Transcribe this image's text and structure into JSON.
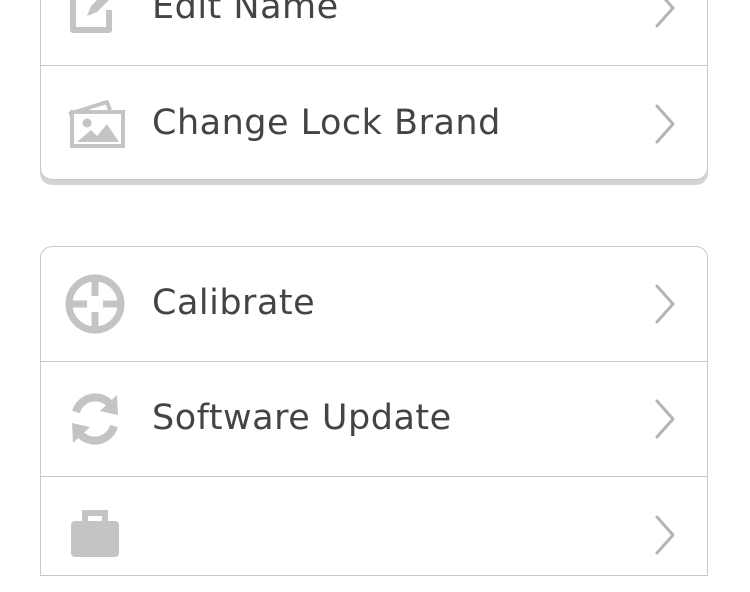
{
  "colors": {
    "icon": "#c4c4c4",
    "text": "#444444",
    "chevron": "#b4b4b4",
    "border": "#c8c8c8",
    "shadow": "#d4d4d4"
  },
  "groups": [
    {
      "items": [
        {
          "label": "Edit Name",
          "icon": "edit-icon"
        },
        {
          "label": "Change Lock Brand",
          "icon": "image-icon"
        }
      ]
    },
    {
      "items": [
        {
          "label": "Calibrate",
          "icon": "crosshair-icon"
        },
        {
          "label": "Software Update",
          "icon": "refresh-icon"
        },
        {
          "label": "",
          "icon": "briefcase-icon"
        }
      ]
    }
  ]
}
